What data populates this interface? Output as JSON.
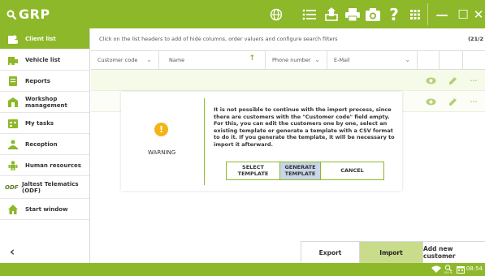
{
  "app": {
    "brand": "GRP"
  },
  "colors": {
    "accent": "#8db829",
    "row_bg": "#f2f7dc",
    "warning": "#f4b417",
    "selected_button": "#c8d6e8"
  },
  "toolbar": {
    "icons": [
      "web-icon",
      "list-icon",
      "upload-icon",
      "printer-icon",
      "camera-icon",
      "help-icon",
      "apps-grid-icon"
    ],
    "help_label": "?",
    "window_controls": {
      "minimize": "—",
      "maximize": "☐",
      "close": "✕"
    }
  },
  "sidebar": {
    "items": [
      {
        "label": "Client list",
        "icon": "client-icon",
        "active": true
      },
      {
        "label": "Vehicle list",
        "icon": "vehicle-icon",
        "active": false
      },
      {
        "label": "Reports",
        "icon": "reports-icon",
        "active": false
      },
      {
        "label": "Workshop management",
        "icon": "workshop-icon",
        "active": false
      },
      {
        "label": "My tasks",
        "icon": "tasks-icon",
        "active": false
      },
      {
        "label": "Reception",
        "icon": "reception-icon",
        "active": false
      },
      {
        "label": "Human resources",
        "icon": "hr-icon",
        "active": false
      },
      {
        "label": "Jaltest Telematics (ODF)",
        "icon": "odf-icon",
        "active": false
      },
      {
        "label": "Start window",
        "icon": "home-icon",
        "active": false
      }
    ],
    "odf_logo": "ODF",
    "back": "‹"
  },
  "content": {
    "hint": "Click on the list headers to add of hide columns, order valuers and configure search filters",
    "count": "(21/2",
    "columns": [
      {
        "label": "Customer code",
        "indicator": "⌄"
      },
      {
        "label": "Name",
        "indicator": "↑"
      },
      {
        "label": "Phone number",
        "indicator": "⌄"
      },
      {
        "label": "E-Mail",
        "indicator": "⌄"
      }
    ],
    "row_actions": {
      "view": "view-icon",
      "edit": "edit-icon",
      "more": "···"
    }
  },
  "bottom_buttons": {
    "export": "Export",
    "import": "Import",
    "add_new": "Add new customer"
  },
  "dialog": {
    "icon": "!",
    "title": "WARNING",
    "message": "It is not possible to continue with the import process, since there are customers with the \"Customer code\" field empty. For this, you can edit the customers one by one, select an existing template or generate a template with a CSV format to do it. If you generate the template, it will be necessary to import it afterward.",
    "buttons": {
      "select_template": "SELECT TEMPLATE",
      "generate_template": "GENERATE TEMPLATE",
      "cancel": "CANCEL"
    }
  },
  "statusbar": {
    "time": "08:54",
    "battery": "100 %"
  }
}
